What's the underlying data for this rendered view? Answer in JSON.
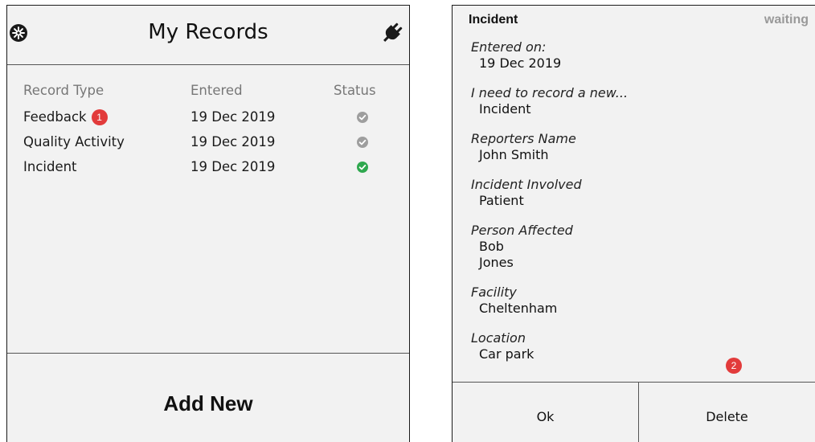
{
  "left": {
    "title": "My Records",
    "columns": {
      "type": "Record Type",
      "entered": "Entered",
      "status": "Status"
    },
    "records": [
      {
        "type": "Feedback",
        "badge": "1",
        "entered": "19 Dec 2019",
        "status_icon": "check-circle-icon",
        "status_color": "#9e9e9e"
      },
      {
        "type": "Quality Activity",
        "entered": "19 Dec 2019",
        "status_icon": "check-circle-icon",
        "status_color": "#9e9e9e"
      },
      {
        "type": "Incident",
        "entered": "19 Dec 2019",
        "status_icon": "check-circle-icon",
        "status_color": "#2fa84f"
      }
    ],
    "add_new_label": "Add New"
  },
  "right": {
    "title": "Incident",
    "status": "waiting",
    "fields": [
      {
        "label": "Entered on:",
        "values": [
          "19 Dec 2019"
        ]
      },
      {
        "label": "I need to record a new...",
        "values": [
          "Incident"
        ]
      },
      {
        "label": "Reporters Name",
        "values": [
          "John Smith"
        ]
      },
      {
        "label": "Incident Involved",
        "values": [
          "Patient"
        ]
      },
      {
        "label": "Person Affected",
        "values": [
          "Bob",
          "Jones"
        ]
      },
      {
        "label": "Facility",
        "values": [
          "Cheltenham"
        ]
      },
      {
        "label": "Location",
        "values": [
          "Car park"
        ]
      }
    ],
    "badge": "2",
    "ok_label": "Ok",
    "delete_label": "Delete"
  },
  "colors": {
    "badge": "#e23b3b",
    "panel_bg": "#f2f2f2"
  }
}
